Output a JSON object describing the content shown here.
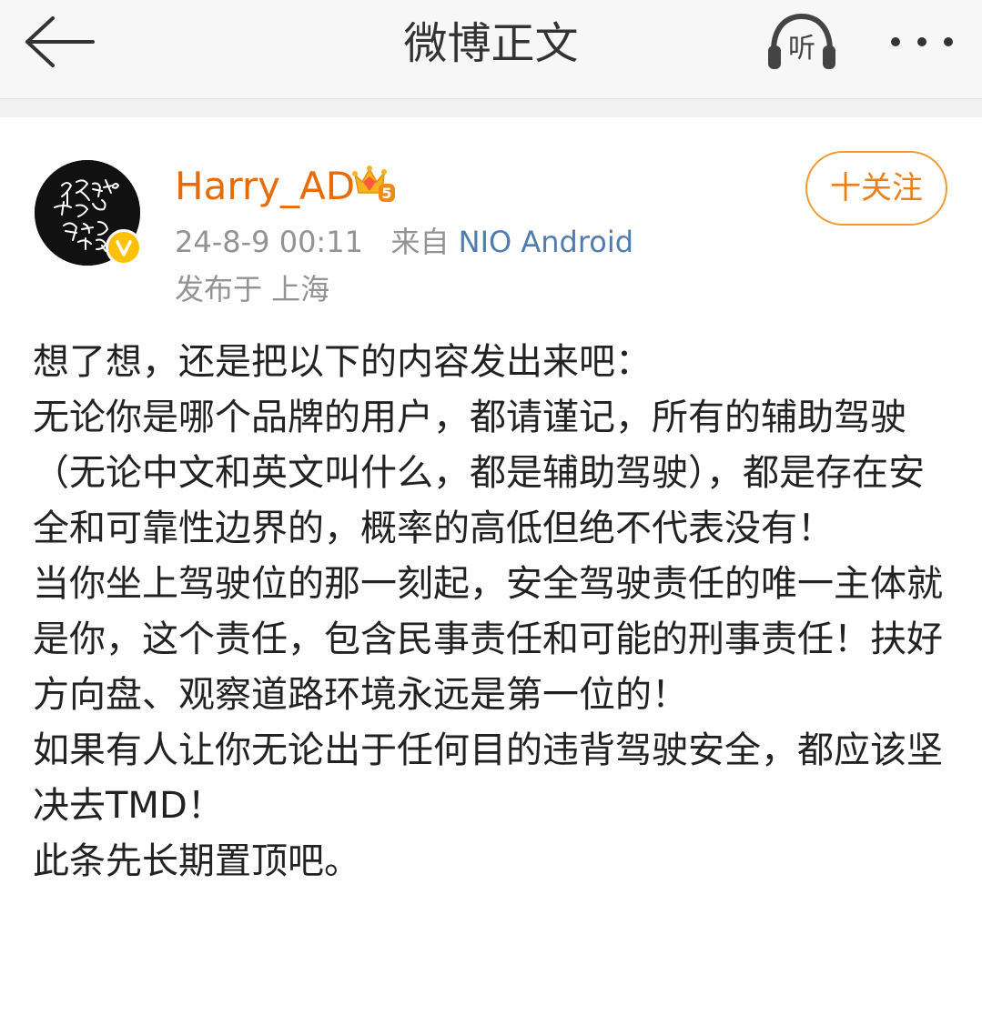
{
  "navbar": {
    "title": "微博正文",
    "listen_label": "听",
    "icons": {
      "back": "back-arrow-icon",
      "listen": "headphones-listen-icon",
      "more": "more-dots-icon"
    }
  },
  "post": {
    "author": {
      "name": "Harry_AD",
      "avatar_text": "宇宙的有趣我才不在意",
      "verified_badge_icon": "verified-v-icon",
      "member_badge_icon": "vip-crown-level-icon",
      "member_level": "5"
    },
    "time": "24-8-9 00:11",
    "source_prefix": "来自",
    "source": "NIO Android",
    "location": "发布于 上海",
    "follow_label": "十关注",
    "body": "想了想，还是把以下的内容发出来吧：\n无论你是哪个品牌的用户，都请谨记，所有的辅助驾驶（无论中文和英文叫什么，都是辅助驾驶），都是存在安全和可靠性边界的，概率的高低但绝不代表没有！\n当你坐上驾驶位的那一刻起，安全驾驶责任的唯一主体就是你，这个责任，包含民事责任和可能的刑事责任！扶好方向盘、观察道路环境永远是第一位的！\n如果有人让你无论出于任何目的违背驾驶安全，都应该坚决去TMD！\n此条先长期置顶吧。"
  },
  "colors": {
    "username": "#e86b0a",
    "source_link": "#507daf",
    "follow_border": "#f09a38",
    "meta_gray": "#939393",
    "verified_yellow": "#ffc107"
  }
}
